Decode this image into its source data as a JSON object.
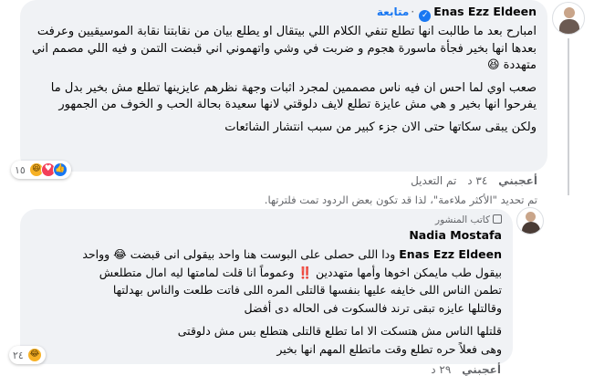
{
  "comment1": {
    "author": "Enas Ezz Eldeen",
    "follow_label": "متابعة",
    "separator": "·",
    "paragraphs": [
      "امبارح بعد ما طالبت انها تطلع تنفي الكلام اللي بيتقال او يطلع بيان من نقابتنا نقابة الموسيقيين وعرفت بعدها انها بخير فجأة ماسورة هجوم و ضربت في وشي واتهموني اني قبضت التمن و فيه اللي مصمم اني متهددة 😆",
      "صعب اوي لما احس ان فيه ناس مصممين لمجرد اثبات وجهة نظرهم عايزينها تطلع مش بخير بدل ما يفرحوا انها بخير و هي مش عايزة تطلع لايف دلوقتي لانها سعيدة بحالة الحب و الخوف من الجمهور",
      "ولكن يبقى سكاتها حتى الان جزء كبير من سبب انتشار الشائعات"
    ],
    "reaction_count": "١٥",
    "actions": {
      "like": "أعجبني",
      "time": "٣٤ د",
      "edited": "تم التعديل"
    }
  },
  "filter_notice": "تم تحديد \"الأكثر ملاءمة\"، لذا قد تكون بعض الردود تمت فلترتها.",
  "comment2": {
    "badge": "كاتب المنشور",
    "author": "Nadia Mostafa",
    "mention": "Enas Ezz Eldeen",
    "lines": [
      "ودا اللى حصلى على البوست هنا واحد بيقولى انى قبضت 😂 وواحد",
      "بيقول طب مايمكن اخوها وأمها متهددين ‼️ وعموماً انا قلت لمامتها ليه امال متطلعش",
      "تطمن الناس اللى خايفه عليها بنفسها قالتلى المره اللى فاتت طلعت والناس بهدلتها",
      "وقالتلها عايزه تبقى ترند فالسكوت فى الحاله دى أفضل",
      "قلتلها الناس مش هتسكت الا اما تطلع قالتلى هتطلع بس مش دلوقتى",
      "وهى فعلاً حره تطلع وقت ماتطلع المهم انها بخير"
    ],
    "reaction_count": "٢٤",
    "actions": {
      "like": "أعجبني",
      "time": "٢٩ د"
    }
  },
  "colors": {
    "bubble": "#f0f2f5",
    "link_blue": "#1877f2",
    "meta_gray": "#65676b",
    "text": "#050505"
  }
}
